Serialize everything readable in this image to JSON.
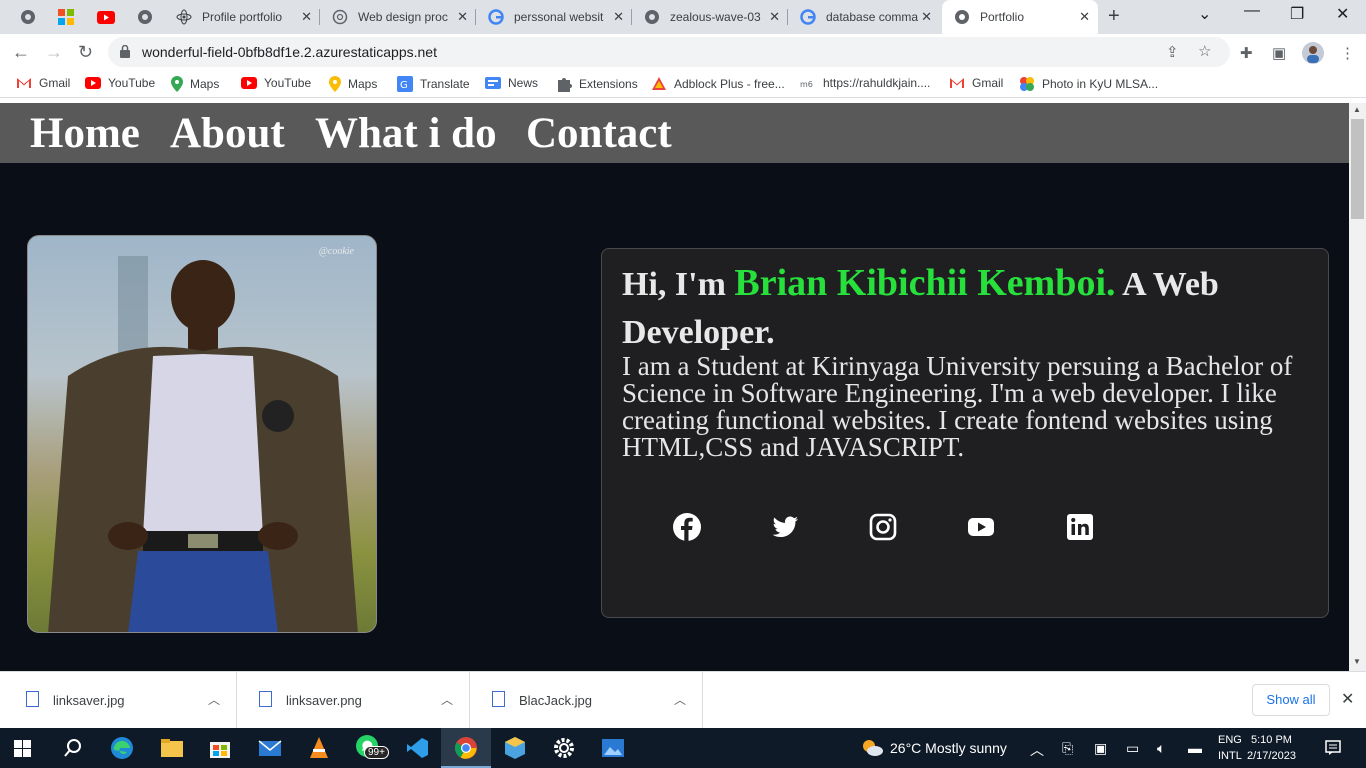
{
  "browser": {
    "tabs": [
      {
        "title": "Profile portfolio",
        "icon": "react-icon"
      },
      {
        "title": "Web design proc",
        "icon": "chatgpt-icon"
      },
      {
        "title": "perssonal websit",
        "icon": "google-icon"
      },
      {
        "title": "zealous-wave-03",
        "icon": "globe-icon"
      },
      {
        "title": "database comma",
        "icon": "google-icon"
      },
      {
        "title": "Portfolio",
        "icon": "globe-icon"
      }
    ],
    "url": "wonderful-field-0bfb8df1e.2.azurestaticapps.net"
  },
  "bookmarks": [
    {
      "label": "Gmail",
      "icon": "gmail-icon"
    },
    {
      "label": "YouTube",
      "icon": "youtube-icon"
    },
    {
      "label": "Maps",
      "icon": "maps-icon"
    },
    {
      "label": "YouTube",
      "icon": "youtube-icon"
    },
    {
      "label": "Maps",
      "icon": "maps-icon"
    },
    {
      "label": "Translate",
      "icon": "translate-icon"
    },
    {
      "label": "News",
      "icon": "news-icon"
    },
    {
      "label": "Extensions",
      "icon": "puzzle-icon"
    },
    {
      "label": "Adblock Plus - free...",
      "icon": "adblock-icon"
    },
    {
      "label": "https://rahuldkjain....",
      "icon": "site-icon"
    },
    {
      "label": "Gmail",
      "icon": "gmail-icon"
    },
    {
      "label": "Photo in KyU MLSA...",
      "icon": "photos-icon"
    }
  ],
  "site": {
    "nav": [
      "Home",
      "About",
      "What i do",
      "Contact"
    ],
    "photo_watermark": "@cookie",
    "heading_prefix": "Hi, I'm ",
    "heading_name": "Brian Kibichii Kemboi.",
    "heading_suffix": " A Web Developer.",
    "bio": "I am a Student at Kirinyaga University persuing a Bachelor of Science in Software Engineering. I'm a web developer. I like creating functional websites. I create fontend websites using HTML,CSS and JAVASCRIPT.",
    "social": [
      "facebook-icon",
      "twitter-icon",
      "instagram-icon",
      "youtube-icon",
      "linkedin-icon"
    ],
    "accent_color": "#27e03c"
  },
  "downloads": {
    "files": [
      "linksaver.jpg",
      "linksaver.png",
      "BlacJack.jpg"
    ],
    "show_all": "Show all"
  },
  "taskbar": {
    "badge": "99+",
    "weather": "26°C  Mostly sunny",
    "lang_line1": "ENG",
    "lang_line2": "INTL",
    "time": "5:10 PM",
    "date": "2/17/2023"
  }
}
